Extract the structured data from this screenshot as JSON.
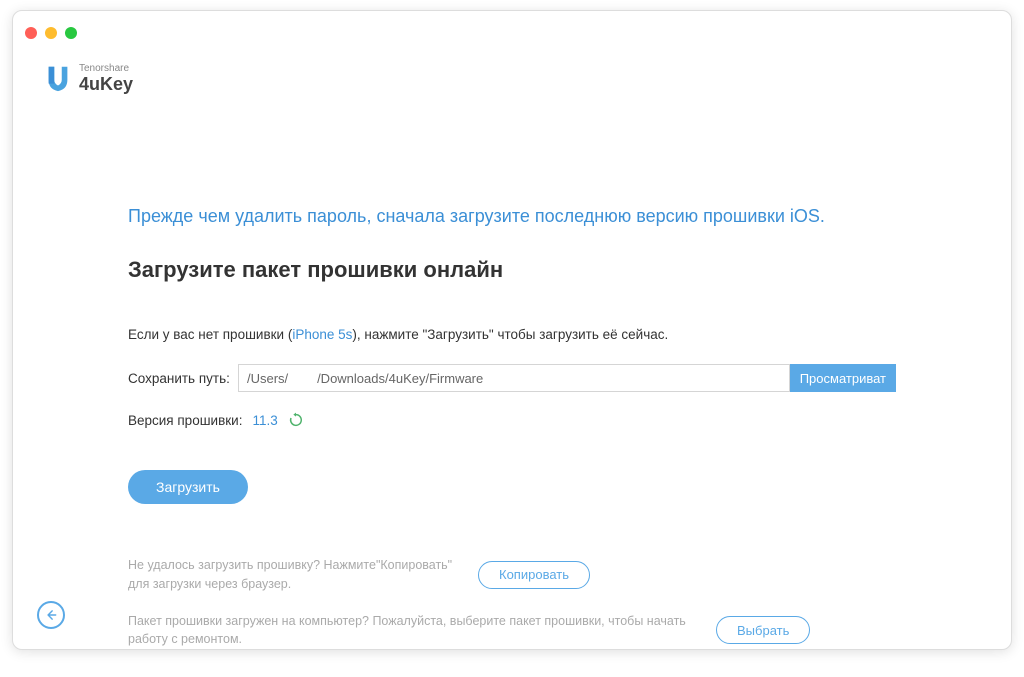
{
  "brand": {
    "small": "Tenorshare",
    "name": "4uKey"
  },
  "banner": "Прежде чем удалить пароль, сначала загрузите последнюю версию прошивки iOS.",
  "heading": "Загрузите пакет прошивки онлайн",
  "no_firmware_prefix": "Если у вас нет прошивки (",
  "device_link": "iPhone 5s",
  "no_firmware_suffix": "), нажмите \"Загрузить\" чтобы загрузить её сейчас.",
  "save_path_label": "Сохранить путь:",
  "save_path_value": "/Users/        /Downloads/4uKey/Firmware",
  "browse_label": "Просматриват",
  "version_label": "Версия прошивки:",
  "version_value": "11.3",
  "download_label": "Загрузить",
  "copy_hint": "Не удалось загрузить прошивку? Нажмите\"Копировать\" для загрузки через браузер.",
  "copy_label": "Копировать",
  "select_hint": "Пакет прошивки загружен на компьютер? Пожалуйста, выберите пакет прошивки, чтобы начать работу с ремонтом.",
  "select_label": "Выбрать"
}
